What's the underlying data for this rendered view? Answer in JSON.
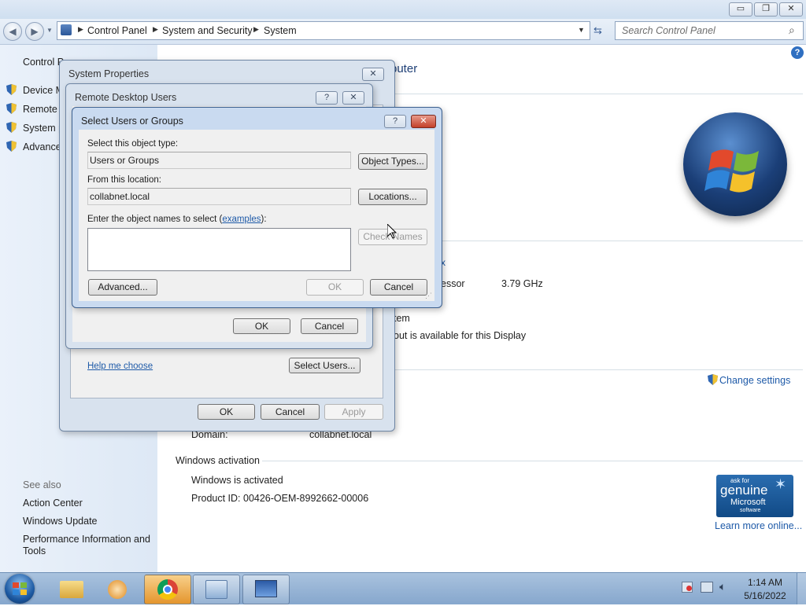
{
  "window": {
    "caption_buttons": [
      "▭",
      "❐",
      "✕"
    ]
  },
  "navbar": {
    "breadcrumbs": [
      "Control Panel",
      "System and Security",
      "System"
    ],
    "search_placeholder": "Search Control Panel"
  },
  "sidebar": {
    "home": "Control P",
    "items": [
      "Device M",
      "Remote s",
      "System p",
      "Advance"
    ],
    "see_also_title": "See also",
    "see_also": [
      "Action Center",
      "Windows Update",
      "Performance Information and",
      "Tools"
    ]
  },
  "main": {
    "heading_partial": "puter",
    "bullet_x": "x",
    "processor_label": "essor",
    "processor_speed": "3.79 GHz",
    "system_type_partial": "tem",
    "pen_touch_partial": "out is available for this Display",
    "change_settings": "Change settings",
    "domain_label": "Domain:",
    "domain_value": "collabnet.local",
    "activation_title": "Windows activation",
    "activation_status": "Windows is activated",
    "product_id": "Product ID: 00426-OEM-8992662-00006",
    "genuine_line1": "ask for",
    "genuine_line2": "genuine",
    "genuine_line3": "Microsoft",
    "genuine_line4": "software",
    "learn_more": "Learn more online..."
  },
  "system_properties": {
    "title": "System Properties",
    "help_me_choose": "Help me choose",
    "select_users_btn": "Select Users...",
    "ok": "OK",
    "cancel": "Cancel",
    "apply": "Apply"
  },
  "remote_desktop_users": {
    "title": "Remote Desktop Users",
    "ok": "OK",
    "cancel": "Cancel"
  },
  "select_users": {
    "title": "Select Users or Groups",
    "object_type_label": "Select this object type:",
    "object_type_value": "Users or Groups",
    "object_types_btn": "Object Types...",
    "location_label": "From this location:",
    "location_value": "collabnet.local",
    "locations_btn": "Locations...",
    "enter_names_label": "Enter the object names to select (",
    "examples_link": "examples",
    "enter_names_label_end": "):",
    "check_names_btn": "Check Names",
    "advanced_btn": "Advanced...",
    "ok": "OK",
    "cancel": "Cancel"
  },
  "taskbar": {
    "time": "1:14 AM",
    "date": "5/16/2022"
  },
  "colors": {
    "link": "#1e5aa8",
    "taskbar": "#94b2d6"
  }
}
